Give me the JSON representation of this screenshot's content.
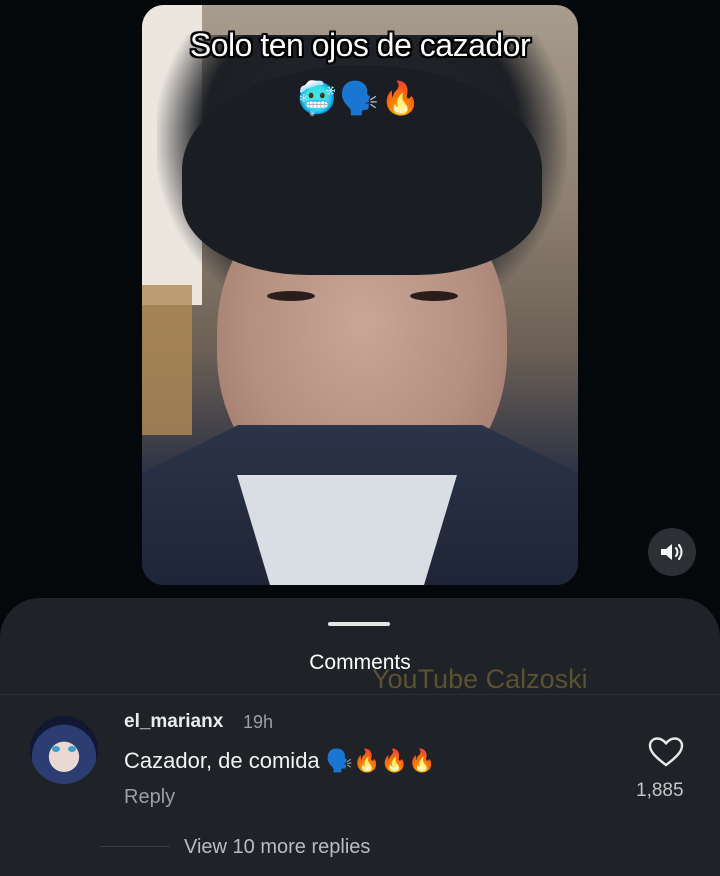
{
  "video": {
    "caption": "Solo ten ojos de cazador",
    "caption_emojis": "🥶🗣️🔥",
    "volume_icon": "speaker-icon"
  },
  "comments_sheet": {
    "title": "Comments",
    "watermark": "YouTube Calzoski",
    "comment": {
      "username": "el_marianx",
      "time": "19h",
      "text": "Cazador, de comida 🗣️🔥🔥🔥",
      "reply_label": "Reply",
      "like_icon": "heart-outline-icon",
      "like_count": "1,885"
    },
    "view_more": "View 10 more replies"
  },
  "colors": {
    "background": "#05080b",
    "sheet": "#1f2226",
    "muted_text": "#9a9ea5"
  }
}
